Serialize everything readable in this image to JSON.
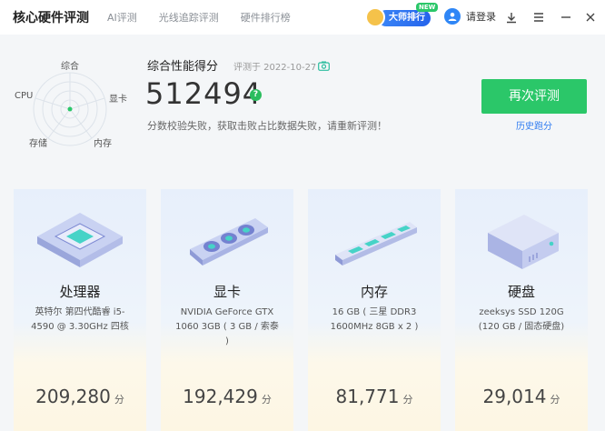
{
  "app": {
    "title": "核心硬件评测"
  },
  "nav": {
    "tabs": [
      "AI评测",
      "光线追踪评测",
      "硬件排行榜"
    ]
  },
  "rank_button": {
    "label": "大师排行",
    "badge": "NEW"
  },
  "login": {
    "label": "请登录"
  },
  "radar": {
    "labels": {
      "top": "综合",
      "right": "显卡",
      "left": "CPU",
      "bottom_left": "存储",
      "bottom_right": "内存"
    }
  },
  "score": {
    "title": "综合性能得分",
    "date": "评测于 2022-10-27",
    "value": "512494",
    "warning": "分数校验失败，获取击败占比数据失败，请重新评测！"
  },
  "actions": {
    "retest": "再次评测",
    "history": "历史跑分"
  },
  "cards": [
    {
      "name": "处理器",
      "desc": "英特尔 第四代酷睿 i5-4590 @ 3.30GHz 四核",
      "score": "209,280",
      "unit": "分"
    },
    {
      "name": "显卡",
      "desc": "NVIDIA GeForce GTX 1060 3GB ( 3 GB / 索泰 )",
      "score": "192,429",
      "unit": "分"
    },
    {
      "name": "内存",
      "desc": "16 GB ( 三星 DDR3 1600MHz 8GB x 2 )",
      "score": "81,771",
      "unit": "分"
    },
    {
      "name": "硬盘",
      "desc": "zeeksys SSD 120G (120 GB / 固态硬盘)",
      "score": "29,014",
      "unit": "分"
    }
  ],
  "colors": {
    "accent_green": "#2bc769",
    "link_blue": "#2f7bf0",
    "brand_blue": "#2563eb"
  }
}
